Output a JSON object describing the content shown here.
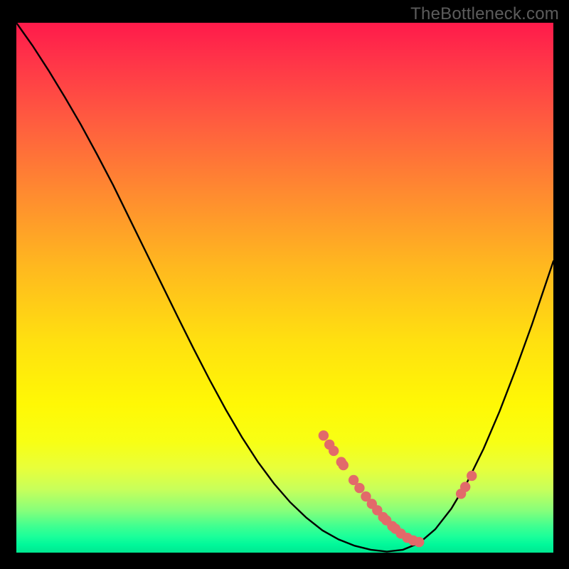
{
  "watermark": "TheBottleneck.com",
  "chart_data": {
    "type": "line",
    "title": "",
    "xlabel": "",
    "ylabel": "",
    "xlim": [
      0,
      100
    ],
    "ylim": [
      0,
      100
    ],
    "series": [
      {
        "name": "curve",
        "color": "#000000",
        "x": [
          0,
          3,
          6,
          9,
          12,
          15,
          18,
          21,
          24,
          27,
          30,
          33,
          36,
          39,
          42,
          45,
          48,
          51,
          54,
          57,
          60,
          63,
          66,
          69,
          72,
          75,
          78,
          81,
          84,
          87,
          90,
          93,
          96,
          100
        ],
        "y": [
          100,
          95.7,
          91,
          86,
          80.8,
          75.2,
          69.4,
          63.2,
          57,
          50.8,
          44.6,
          38.5,
          32.6,
          27,
          21.8,
          17.1,
          13,
          9.5,
          6.6,
          4.2,
          2.5,
          1.3,
          0.55,
          0.2,
          0.55,
          1.8,
          4.4,
          8.3,
          13.4,
          19.6,
          26.7,
          34.6,
          43,
          55
        ]
      },
      {
        "name": "markers",
        "color": "#e26a6a",
        "type": "scatter",
        "x": [
          57.2,
          58.3,
          59.1,
          60.5,
          60.9,
          62.8,
          63.9,
          65.1,
          66.2,
          67.2,
          68.3,
          68.9,
          70.0,
          70.6,
          71.6,
          72.8,
          73.9,
          75.0,
          82.8,
          83.6,
          84.8
        ],
        "y": [
          22.1,
          20.4,
          19.2,
          17.1,
          16.5,
          13.7,
          12.2,
          10.6,
          9.2,
          8.0,
          6.7,
          6.1,
          5.0,
          4.5,
          3.6,
          2.8,
          2.3,
          2.0,
          11.1,
          12.4,
          14.5
        ]
      }
    ],
    "annotations": []
  }
}
